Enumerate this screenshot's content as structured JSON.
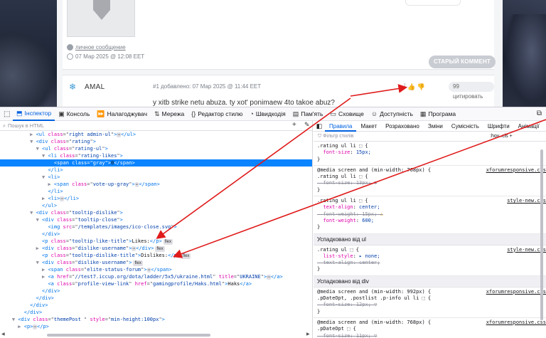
{
  "forum": {
    "post1": {
      "pm_link": "личное сообщение",
      "date": "07 Мар 2025 @ 12:08 EET",
      "old_comment_button": "СТАРЫЙ КОММЕНТ"
    },
    "post2": {
      "username": "AMAL",
      "meta": "#1 добавлено: 07 Мар 2025 @ 11:44 EET",
      "text": "y xitb strike netu abuza. ty xot' ponimaew 4to takoe abuz?",
      "quote_button": "99 цитировать",
      "accent_color": "#3c9ad6"
    }
  },
  "devtools": {
    "tabs": [
      {
        "icon": "inspector-icon",
        "label": "Інспектор"
      },
      {
        "icon": "console-icon",
        "label": "Консоль"
      },
      {
        "icon": "debugger-icon",
        "label": "Налагоджувач"
      },
      {
        "icon": "network-icon",
        "label": "Мережа"
      },
      {
        "icon": "style-editor-icon",
        "label": "Редактор стилю"
      },
      {
        "icon": "performance-icon",
        "label": "Швидкодія"
      },
      {
        "icon": "memory-icon",
        "label": "Пам'ять"
      },
      {
        "icon": "storage-icon",
        "label": "Сховище"
      },
      {
        "icon": "accessibility-icon",
        "label": "Доступність"
      },
      {
        "icon": "application-icon",
        "label": "Програма"
      }
    ],
    "search_placeholder": "Пошук в HTML",
    "accent_color": "#0a84ff",
    "right_tabs": [
      "Правила",
      "Макет",
      "Розраховано",
      "Зміни",
      "Сумісність",
      "Шрифти",
      "Анімації"
    ],
    "filter_placeholder": "Фільтр стилів",
    "filter_controls": ":hov  .cls  +",
    "tree": [
      {
        "indent": 5,
        "tw": "▶",
        "html": "<ul class=\"right admin-ul\">",
        "tail": "</ul>",
        "ell": true
      },
      {
        "indent": 5,
        "tw": "▼",
        "html": "<div class=\"rating\">"
      },
      {
        "indent": 6,
        "tw": "▼",
        "html": "<ul class=\"rating-ul\">"
      },
      {
        "indent": 7,
        "tw": "▼",
        "html": "<li class=\"rating-likes\">"
      },
      {
        "indent": 8,
        "tw": "",
        "html": "<span class=\"gray\">",
        "text": "0",
        "tail": "</span>",
        "selected": true
      },
      {
        "indent": 7,
        "tw": "",
        "html": "</li>"
      },
      {
        "indent": 7,
        "tw": "▼",
        "html": "<li>"
      },
      {
        "indent": 8,
        "tw": "▶",
        "html": "<span class=\"vote-up-gray\">",
        "tail": "</span>",
        "ell": true
      },
      {
        "indent": 7,
        "tw": "",
        "html": "</li>"
      },
      {
        "indent": 7,
        "tw": "▶",
        "html": "<li>",
        "tail": "</li>",
        "ell": true
      },
      {
        "indent": 6,
        "tw": "",
        "html": "</ul>"
      },
      {
        "indent": 5,
        "tw": "▼",
        "html": "<div class=\"tooltip-dislike\">"
      },
      {
        "indent": 6,
        "tw": "▼",
        "html": "<div class=\"tooltip-close\">"
      },
      {
        "indent": 7,
        "tw": "",
        "html": "<img src=\"/templates/images/ico-close.svg\">"
      },
      {
        "indent": 6,
        "tw": "",
        "html": "</div>"
      },
      {
        "indent": 6,
        "tw": "",
        "html": "<p class=\"tooltip-like-title\">",
        "text": "Likes:",
        "tail": "</p>",
        "badge": "flex"
      },
      {
        "indent": 6,
        "tw": "▶",
        "html": "<div class=\"dislike-username\">",
        "tail": "</div>",
        "ell": true,
        "badge": "flex"
      },
      {
        "indent": 6,
        "tw": "",
        "html": "<p class=\"tooltip-dislike-title\">",
        "text": "Dislikes:",
        "tail": "</p>",
        "badge": "flex"
      },
      {
        "indent": 6,
        "tw": "▼",
        "html": "<div class=\"dislike-username\">",
        "badge": "flex"
      },
      {
        "indent": 7,
        "tw": "▶",
        "html": "<span class=\"elite-status-forum\">",
        "tail": "</span>",
        "ell": true
      },
      {
        "indent": 7,
        "tw": "▶",
        "html": "<a href=\"//test7.iccup.org/dota/ladder/5x5/ukraine.html\" title=\"UKRAINE\">",
        "tail": "</a>",
        "ell": true
      },
      {
        "indent": 7,
        "tw": "",
        "html": "<a class=\"profile-view-link\" href=\"gamingprofile/Haks.html\">",
        "text": "Haks",
        "tail": "</a>"
      },
      {
        "indent": 6,
        "tw": "",
        "html": "</div>"
      },
      {
        "indent": 5,
        "tw": "",
        "html": "</div>"
      },
      {
        "indent": 4,
        "tw": "",
        "html": "</div>"
      },
      {
        "indent": 3,
        "tw": "",
        "html": "</div>"
      },
      {
        "indent": 2,
        "tw": "▼",
        "html": "<div class=\"themePost \" style=\"min-height:100px\">"
      },
      {
        "indent": 3,
        "tw": "▶",
        "html": "<p>",
        "tail": "</p>",
        "ell": true
      }
    ],
    "rules": [
      {
        "lines": [
          ".rating ul li ⬚ {",
          "  font-size: 15px;",
          "}"
        ]
      },
      {
        "src": "xforumresponsive.css",
        "lines": [
          "@media screen and (min-width: 768px) {",
          ".rating ul li ⬚ {",
          "  font-size: 13px; ▽",
          "}"
        ]
      },
      {
        "src": "style-new.css",
        "lines": [
          ".rating ul li ⬚ {",
          "  text-align: center;",
          "  font-weight: 15px; ⚠",
          "  font-weight: 600;",
          "}"
        ]
      },
      {
        "header": "Успадковано від ul"
      },
      {
        "src": "style-new.css",
        "lines": [
          ".rating ul ⬚ {",
          "  list-style: ▸ none;",
          "  text-align: center;",
          "}"
        ]
      },
      {
        "header": "Успадковано від div"
      },
      {
        "src": "xforumresponsive.css",
        "lines": [
          "@media screen and (min-width: 992px) {",
          ".pDateOpt, .postlist .p-info ul li ⬚ {",
          "  font-size: 12px; ▽",
          "}"
        ]
      },
      {
        "src": "xforumresponsive.css",
        "lines": [
          "@media screen and (min-width: 768px) {",
          ".pDateOpt ⬚ {",
          "  font-size: 11px; ▽"
        ]
      }
    ]
  }
}
